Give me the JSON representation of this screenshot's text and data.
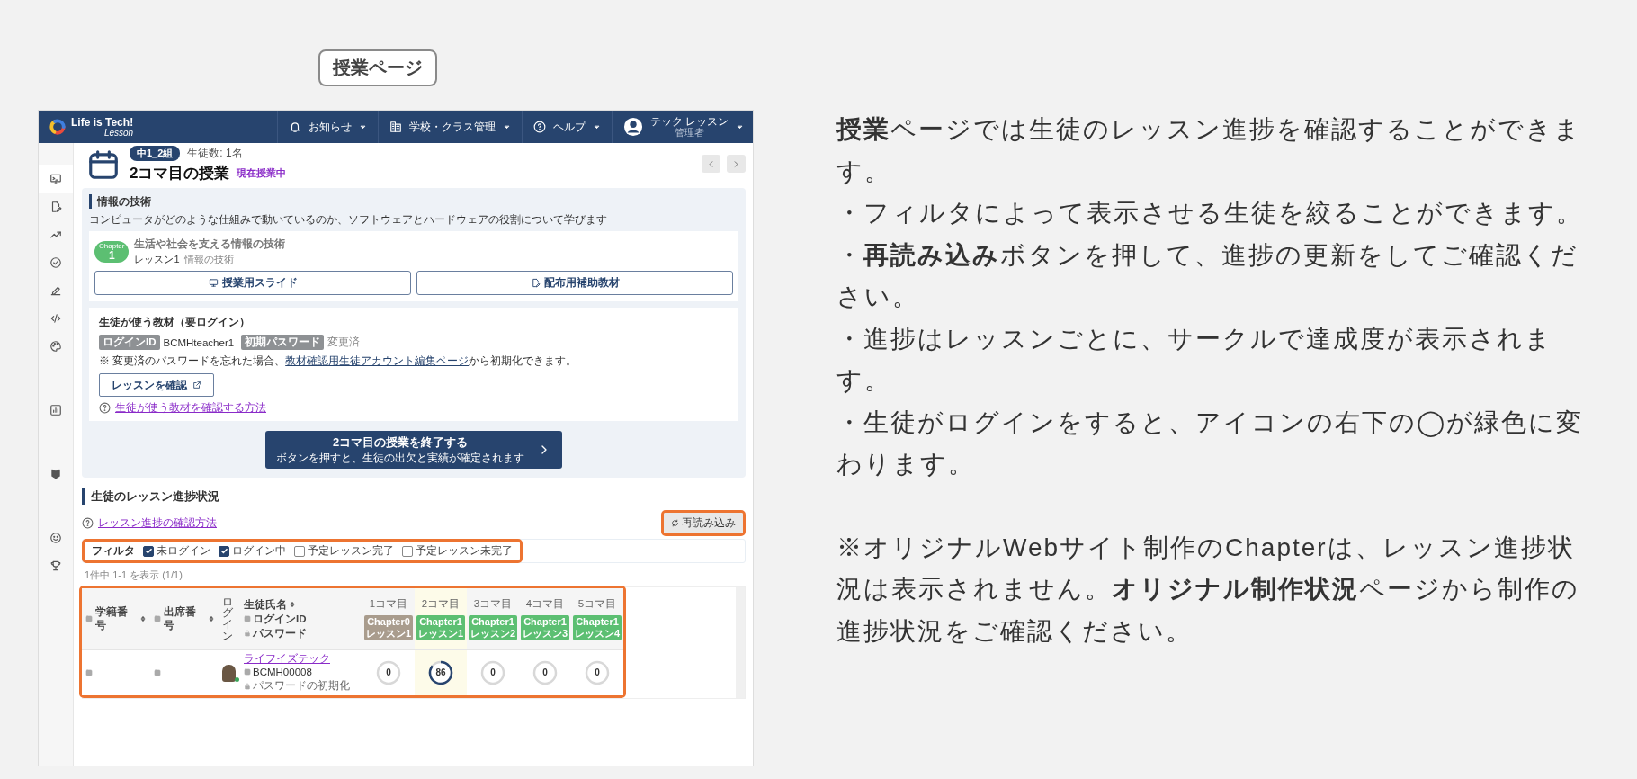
{
  "page_label": "授業ページ",
  "app": {
    "logo": {
      "name": "Life is Tech!",
      "sub": "Lesson"
    },
    "nav": [
      {
        "label": "お知らせ"
      },
      {
        "label": "学校・クラス管理"
      },
      {
        "label": "ヘルプ"
      }
    ],
    "user": {
      "name": "テック レッスン",
      "role": "管理者"
    },
    "class_badge": "中1_2組",
    "student_count": "生徒数: 1名",
    "title": "2コマ目の授業",
    "status": "現在授業中",
    "unit": {
      "title": "情報の技術",
      "description": "コンピュータがどのような仕組みで動いているのか、ソフトウェアとハードウェアの役割について学びます"
    },
    "chapter": {
      "badge_label": "Chapter",
      "number": "1",
      "title": "生活や社会を支える情報の技術",
      "lesson": "レッスン1",
      "lesson_name": "情報の技術",
      "buttons": [
        "授業用スライド",
        "配布用補助教材"
      ]
    },
    "student_materials": {
      "title": "生徒が使う教材（要ログイン）",
      "login_id_label": "ログインID",
      "login_id": "BCMHteacher1",
      "password_label": "初期パスワード",
      "password": "変更済",
      "note_prefix": "※ 変更済のパスワードを忘れた場合、",
      "note_link": "教材確認用生徒アカウント編集ページ",
      "note_suffix": "から初期化できます。",
      "check_button": "レッスンを確認",
      "help_link": "生徒が使う教材を確認する方法"
    },
    "end_button": {
      "title": "2コマ目の授業を終了する",
      "subtitle": "ボタンを押すと、生徒の出欠と実績が確定されます"
    },
    "progress": {
      "title": "生徒のレッスン進捗状況",
      "help_link": "レッスン進捗の確認方法",
      "reload_button": "再読み込み",
      "filter_label": "フィルタ",
      "filters": [
        {
          "label": "未ログイン",
          "checked": true
        },
        {
          "label": "ログイン中",
          "checked": true
        },
        {
          "label": "予定レッスン完了",
          "checked": false
        },
        {
          "label": "予定レッスン未完了",
          "checked": false
        }
      ],
      "count": "1件中 1-1 を表示 (1/1)",
      "table": {
        "columns": [
          {
            "label": "学籍番号"
          },
          {
            "label": "出席番号"
          },
          {
            "label": "ログイン"
          },
          {
            "label": "生徒氏名",
            "sub": [
              "ログインID",
              "パスワード"
            ]
          }
        ],
        "periods": [
          {
            "label": "1コマ目",
            "chapter": "Chapter0",
            "lesson": "レッスン1",
            "color": "#a99c8d",
            "selected": false
          },
          {
            "label": "2コマ目",
            "chapter": "Chapter1",
            "lesson": "レッスン1",
            "color": "#5cbf72",
            "selected": true
          },
          {
            "label": "3コマ目",
            "chapter": "Chapter1",
            "lesson": "レッスン2",
            "color": "#5cbf72",
            "selected": false
          },
          {
            "label": "4コマ目",
            "chapter": "Chapter1",
            "lesson": "レッスン3",
            "color": "#5cbf72",
            "selected": false
          },
          {
            "label": "5コマ目",
            "chapter": "Chapter1",
            "lesson": "レッスン4",
            "color": "#5cbf72",
            "selected": false
          }
        ],
        "rows": [
          {
            "name": "ライフイズテック",
            "login_id": "BCMH00008",
            "password_reset": "パスワードの初期化",
            "online": true,
            "progress": [
              {
                "value": "0",
                "level": 0
              },
              {
                "value": "86",
                "level": 0.86
              },
              {
                "value": "0",
                "level": 0
              },
              {
                "value": "0",
                "level": 0
              },
              {
                "value": "0",
                "level": 0
              }
            ]
          }
        ]
      }
    }
  },
  "description": [
    "**授業**ページでは生徒のレッスン進捗を確認することができます。",
    "・フィルタによって表示させる生徒を絞ることができます。",
    "・**再読み込み**ボタンを押して、進捗の更新をしてご確認ください。",
    "・進捗はレッスンごとに、サークルで達成度が表示されます。",
    "・生徒がログインをすると、アイコンの右下の◯が緑色に変わります。"
  ],
  "note": "※オリジナルWebサイト制作のChapterは、レッスン進捗状況は表示されません。**オリジナル制作状況**ページから制作の進捗状況をご確認ください。"
}
